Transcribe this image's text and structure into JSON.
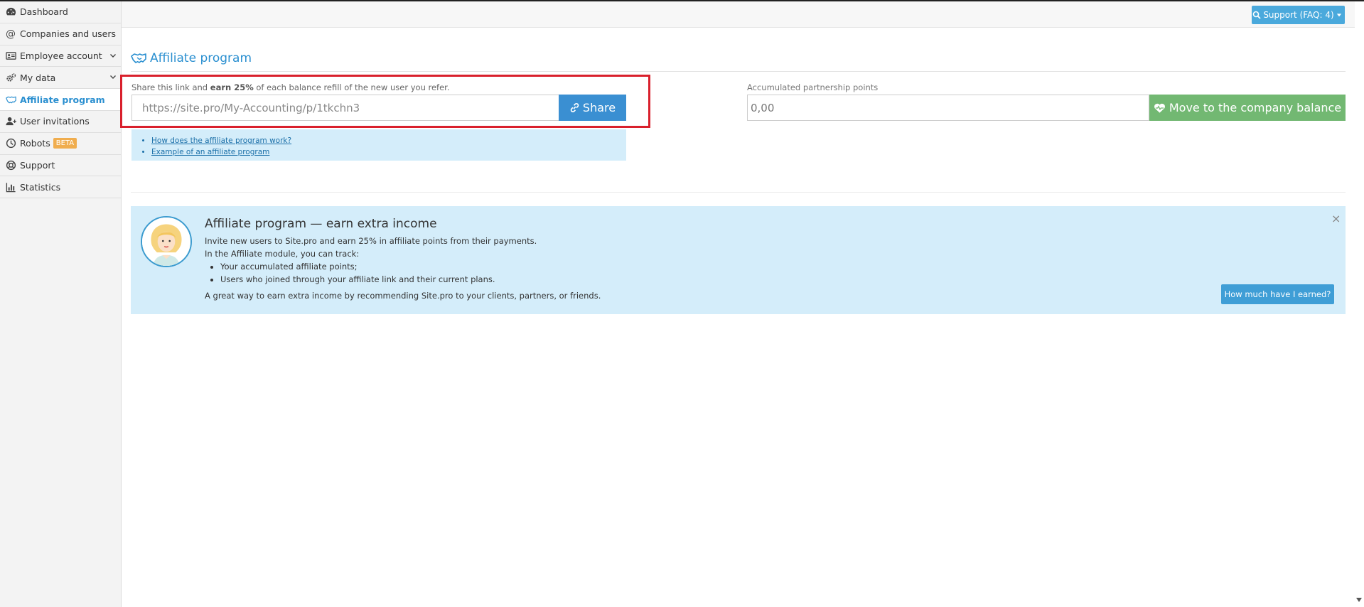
{
  "sidebar": {
    "items": [
      {
        "label": "Dashboard",
        "icon": "dashboard-icon"
      },
      {
        "label": "Companies and users",
        "icon": "at-icon"
      },
      {
        "label": "Employee account",
        "icon": "id-card-icon"
      },
      {
        "label": "My data",
        "icon": "gears-icon"
      },
      {
        "label": "Affiliate program",
        "icon": "handshake-icon"
      },
      {
        "label": "User invitations",
        "icon": "user-plus-icon"
      },
      {
        "label": "Robots",
        "icon": "clock-icon",
        "badge": "BETA"
      },
      {
        "label": "Support",
        "icon": "life-ring-icon"
      },
      {
        "label": "Statistics",
        "icon": "bar-chart-icon"
      }
    ]
  },
  "topbar": {
    "support_label": "Support (FAQ: 4)"
  },
  "page": {
    "title": "Affiliate program"
  },
  "share": {
    "caption_prefix": "Share this link and ",
    "caption_bold": "earn 25%",
    "caption_suffix": " of each balance refill of the new user you refer.",
    "link_value": "https://site.pro/My-Accounting/p/1tkchn3",
    "button_label": "Share"
  },
  "help": {
    "links": [
      "How does the affiliate program work?",
      "Example of an affiliate program"
    ]
  },
  "points": {
    "caption": "Accumulated partnership points",
    "value": "0,00",
    "button_label": "Move to the company balance"
  },
  "promo": {
    "title": "Affiliate program — earn extra income",
    "line1": "Invite new users to Site.pro and earn 25% in affiliate points from their payments.",
    "line2": "In the Affiliate module, you can track:",
    "bullets": [
      "Your accumulated affiliate points;",
      "Users who joined through your affiliate link and their current plans."
    ],
    "footer": "A great way to earn extra income by recommending Site.pro to your clients, partners, or friends.",
    "close_label": "×",
    "earned_button": "How much have I earned?"
  },
  "colors": {
    "accent": "#2a8fd0",
    "highlight": "#d9202c",
    "success": "#72b872",
    "info_bg": "#d4edfa",
    "beta": "#f0ad4e"
  }
}
